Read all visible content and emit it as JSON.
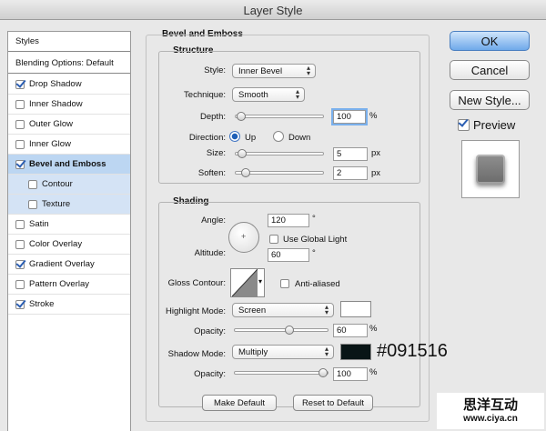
{
  "window": {
    "title": "Layer Style"
  },
  "stylelist": {
    "header": "Styles",
    "blending": "Blending Options: Default",
    "items": [
      {
        "label": "Drop Shadow",
        "checked": true
      },
      {
        "label": "Inner Shadow",
        "checked": false
      },
      {
        "label": "Outer Glow",
        "checked": false
      },
      {
        "label": "Inner Glow",
        "checked": false
      },
      {
        "label": "Bevel and Emboss",
        "checked": true
      },
      {
        "label": "Contour",
        "checked": false
      },
      {
        "label": "Texture",
        "checked": false
      },
      {
        "label": "Satin",
        "checked": false
      },
      {
        "label": "Color Overlay",
        "checked": false
      },
      {
        "label": "Gradient Overlay",
        "checked": true
      },
      {
        "label": "Pattern Overlay",
        "checked": false
      },
      {
        "label": "Stroke",
        "checked": true
      }
    ]
  },
  "buttons": {
    "ok": "OK",
    "cancel": "Cancel",
    "new_style": "New Style...",
    "preview": "Preview",
    "make_default": "Make Default",
    "reset_default": "Reset to Default"
  },
  "bevel": {
    "title": "Bevel and Emboss",
    "structure": {
      "title": "Structure",
      "style_label": "Style:",
      "style_value": "Inner Bevel",
      "technique_label": "Technique:",
      "technique_value": "Smooth",
      "depth_label": "Depth:",
      "depth_value": "100",
      "depth_unit": "%",
      "depth_slider": 0.01,
      "direction_label": "Direction:",
      "direction_up": "Up",
      "direction_down": "Down",
      "size_label": "Size:",
      "size_value": "5",
      "size_unit": "px",
      "size_slider": 0.02,
      "soften_label": "Soften:",
      "soften_value": "2",
      "soften_unit": "px",
      "soften_slider": 0.07
    },
    "shading": {
      "title": "Shading",
      "angle_label": "Angle:",
      "angle_value": "120",
      "angle_unit": "°",
      "global_light": "Use Global Light",
      "altitude_label": "Altitude:",
      "altitude_value": "60",
      "altitude_unit": "°",
      "gloss_label": "Gloss Contour:",
      "anti_aliased": "Anti-aliased",
      "highlight_label": "Highlight Mode:",
      "highlight_value": "Screen",
      "highlight_color": "#ffffff",
      "hl_opacity_label": "Opacity:",
      "hl_opacity_value": "60",
      "hl_opacity_unit": "%",
      "hl_opacity_slider": 0.6,
      "shadow_label": "Shadow Mode:",
      "shadow_value": "Multiply",
      "shadow_color": "#091516",
      "shadow_annotation": "#091516",
      "sh_opacity_label": "Opacity:",
      "sh_opacity_value": "100",
      "sh_opacity_unit": "%",
      "sh_opacity_slider": 1.0
    }
  },
  "watermark": {
    "line1": "思洋互动",
    "line2": "www.ciya.cn"
  }
}
